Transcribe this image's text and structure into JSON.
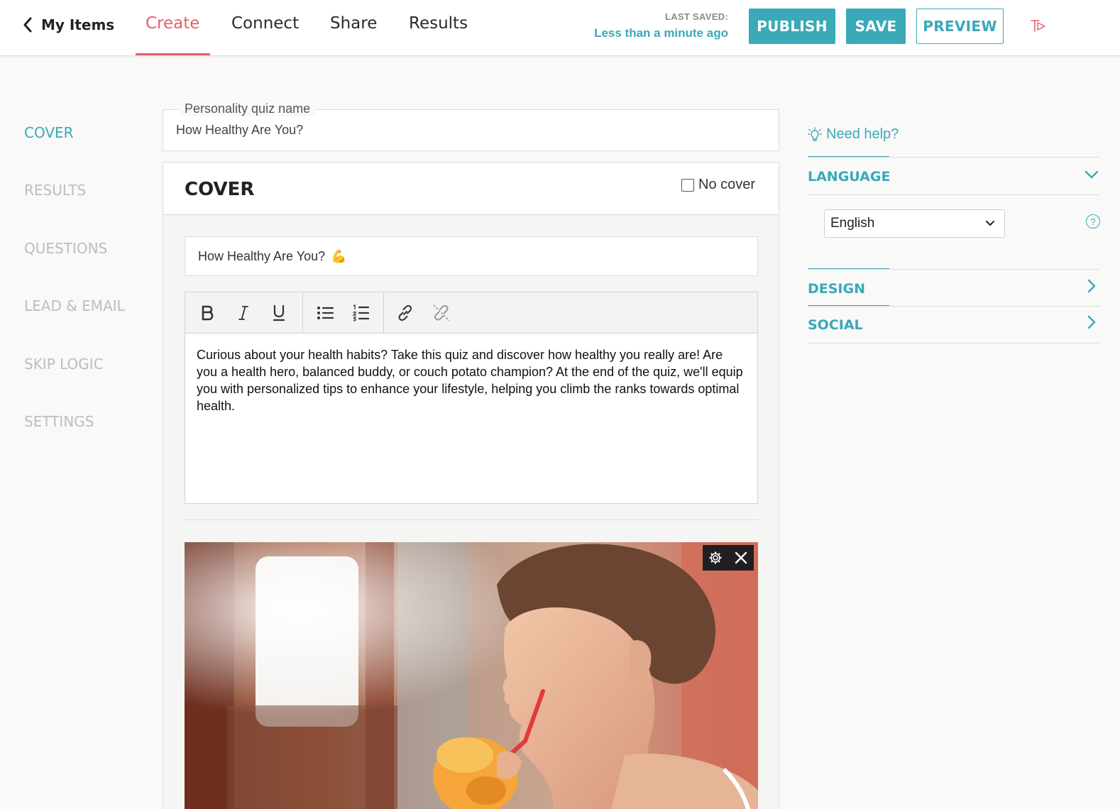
{
  "header": {
    "back_label": "My Items",
    "tabs": [
      {
        "label": "Create",
        "active": true
      },
      {
        "label": "Connect",
        "active": false
      },
      {
        "label": "Share",
        "active": false
      },
      {
        "label": "Results",
        "active": false
      }
    ],
    "last_saved_label": "LAST SAVED:",
    "last_saved_value": "Less than a minute ago",
    "publish_label": "PUBLISH",
    "save_label": "SAVE",
    "preview_label": "PREVIEW"
  },
  "sidebar": {
    "items": [
      {
        "label": "COVER",
        "active": true
      },
      {
        "label": "RESULTS",
        "active": false
      },
      {
        "label": "QUESTIONS",
        "active": false
      },
      {
        "label": "LEAD & EMAIL",
        "active": false
      },
      {
        "label": "SKIP LOGIC",
        "active": false
      },
      {
        "label": "SETTINGS",
        "active": false
      }
    ]
  },
  "main": {
    "quiz_name_label": "Personality quiz name",
    "quiz_name_value": "How Healthy Are You?",
    "cover": {
      "heading": "COVER",
      "no_cover_label": "No cover",
      "no_cover_checked": false,
      "title_value": "How Healthy Are You?",
      "title_emoji": "💪",
      "description": "Curious about your health habits? Take this quiz and discover how healthy you really are! Are you a health hero, balanced buddy, or couch potato champion? At the end of the quiz, we'll equip you with personalized tips to enhance your lifestyle, helping you climb the ranks towards optimal health."
    },
    "toolbar_icons": [
      "bold-icon",
      "italic-icon",
      "underline-icon",
      "bullet-list-icon",
      "numbered-list-icon",
      "link-icon",
      "unlink-icon"
    ]
  },
  "right_panel": {
    "help_label": "Need help?",
    "sections": [
      {
        "label": "LANGUAGE",
        "expanded": true
      },
      {
        "label": "DESIGN",
        "expanded": false
      },
      {
        "label": "SOCIAL",
        "expanded": false
      }
    ],
    "language_selected": "English",
    "language_help_glyph": "?"
  },
  "colors": {
    "accent": "#3aa9b8",
    "active_tab": "#e8606a",
    "inactive_nav": "#bdbdbd"
  }
}
